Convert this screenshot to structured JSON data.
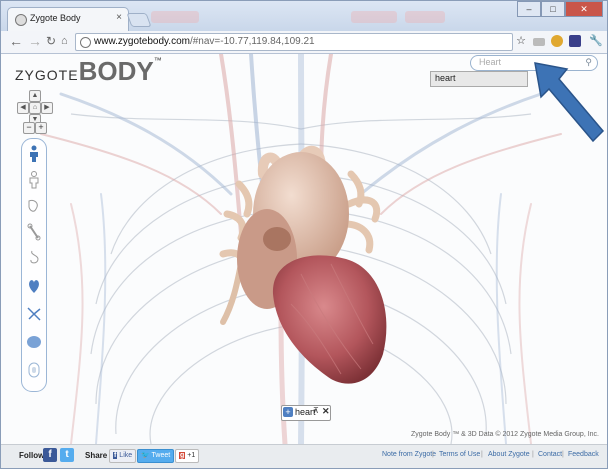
{
  "browser": {
    "tab_title": "Zygote Body",
    "tab_close": "×",
    "url_host": "www.zygotebody.com",
    "url_rest": "/#nav=-10.77,119.84,109.21",
    "buttons": {
      "minimize": "–",
      "maximize": "□",
      "close": "✕"
    }
  },
  "logo": {
    "prefix": "ZYGOTE",
    "main": "BODY",
    "tm": "™"
  },
  "search": {
    "placeholder": "Heart",
    "suggestion": "heart"
  },
  "selected_chip": {
    "add": "+",
    "label": "heart",
    "pin": "⊼",
    "remove": "✕"
  },
  "copyright": "Zygote Body ™ & 3D Data © 2012 Zygote Media Group, Inc.",
  "footer": {
    "follow_label": "Follow",
    "share_label": "Share",
    "like_label": "Like",
    "tweet_label": "Tweet",
    "plus_label": "+1",
    "links": [
      "Note from Zygote",
      "Terms of Use",
      "About Zygote",
      "Contact",
      "Feedback"
    ],
    "separator": "|"
  },
  "icons": [
    "favicon-icon",
    "back-icon",
    "forward-icon",
    "reload-icon",
    "home-icon",
    "star-icon",
    "wrench-icon",
    "search-icon",
    "pin-icon",
    "close-icon",
    "facebook-icon",
    "twitter-icon",
    "google-plus-icon",
    "pointer-arrow-icon"
  ],
  "colors": {
    "accent_blue": "#3d73b5",
    "heart_red": "#b34a50",
    "facebook": "#3b5998",
    "twitter": "#55acee"
  }
}
